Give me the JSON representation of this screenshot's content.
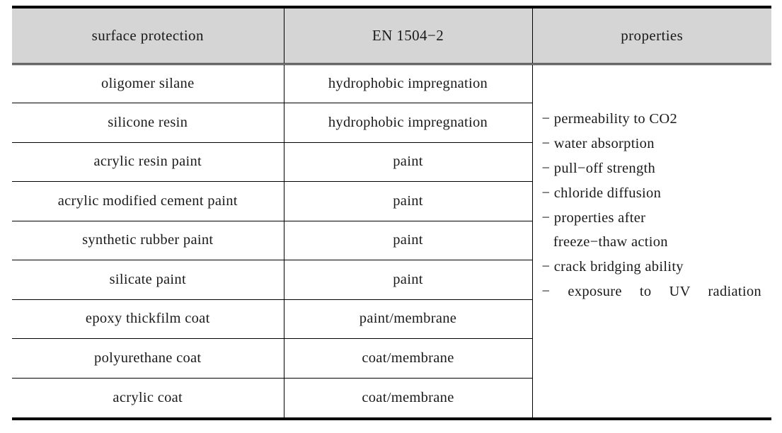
{
  "table": {
    "columns": [
      {
        "key": "surface_protection",
        "label": "surface protection"
      },
      {
        "key": "en_standard",
        "label": "EN 1504−2"
      },
      {
        "key": "properties",
        "label": "properties"
      }
    ],
    "rows": [
      {
        "surface_protection": "oligomer silane",
        "en_standard": "hydrophobic impregnation"
      },
      {
        "surface_protection": "silicone resin",
        "en_standard": "hydrophobic impregnation"
      },
      {
        "surface_protection": "acrylic resin paint",
        "en_standard": "paint"
      },
      {
        "surface_protection": "acrylic modified cement paint",
        "en_standard": "paint"
      },
      {
        "surface_protection": "synthetic rubber paint",
        "en_standard": "paint"
      },
      {
        "surface_protection": "silicate paint",
        "en_standard": "paint"
      },
      {
        "surface_protection": "epoxy thickfilm coat",
        "en_standard": "paint/membrane"
      },
      {
        "surface_protection": "polyurethane coat",
        "en_standard": "coat/membrane"
      },
      {
        "surface_protection": "acrylic coat",
        "en_standard": "coat/membrane"
      }
    ],
    "properties_items": [
      "− permeability to CO2",
      "− water absorption",
      "− pull−off strength",
      "− chloride diffusion",
      "− properties after\n   freeze−thaw action",
      "− crack bridging ability",
      "− exposure to UV radiation"
    ]
  },
  "style": {
    "header_background": "#d5d5d5",
    "border_color": "#000000",
    "page_background": "#ffffff",
    "text_color": "#1a1a1a"
  }
}
